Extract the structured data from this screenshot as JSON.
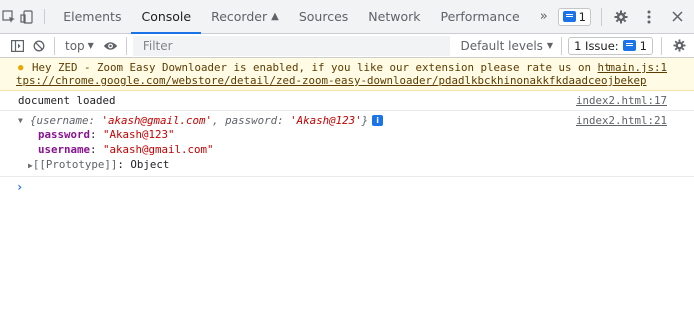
{
  "tabbar": {
    "tabs": [
      {
        "label": "Elements",
        "active": false
      },
      {
        "label": "Console",
        "active": true
      },
      {
        "label": "Recorder",
        "active": false
      },
      {
        "label": "Sources",
        "active": false
      },
      {
        "label": "Network",
        "active": false
      },
      {
        "label": "Performance",
        "active": false
      }
    ],
    "more": "»",
    "issues_count": "1"
  },
  "toolbar": {
    "context": "top",
    "filter_placeholder": "Filter",
    "levels": "Default levels",
    "issue_label": "1 Issue:",
    "issue_count": "1"
  },
  "console": {
    "warning": {
      "text": "Hey ZED - Zoom Easy Downloader is enabled, if you like our extension please rate us on ",
      "link": "ht",
      "source": "main.js:1",
      "url_cont": "tps://chrome.google.com/webstore/detail/zed-zoom-easy-downloader/pdadlkbckhinonakkfkdaadceojbekep"
    },
    "log1": {
      "text": "document loaded",
      "source": "index2.html:17"
    },
    "log2": {
      "source": "index2.html:21",
      "open": "{",
      "k1": "username",
      "v1": "'akash@gmail.com'",
      "sep": ", ",
      "k2": "password",
      "v2": "'Akash@123'",
      "close": "}",
      "props": [
        {
          "key": "password",
          "value": "\"Akash@123\""
        },
        {
          "key": "username",
          "value": "\"akash@gmail.com\""
        }
      ],
      "proto_key": "[[Prototype]]",
      "proto_val": "Object"
    },
    "prompt": "›"
  },
  "colors": {
    "accent": "#1a73e8",
    "warning_bg": "#fffbe5",
    "key": "#881391",
    "string": "#c80000"
  }
}
